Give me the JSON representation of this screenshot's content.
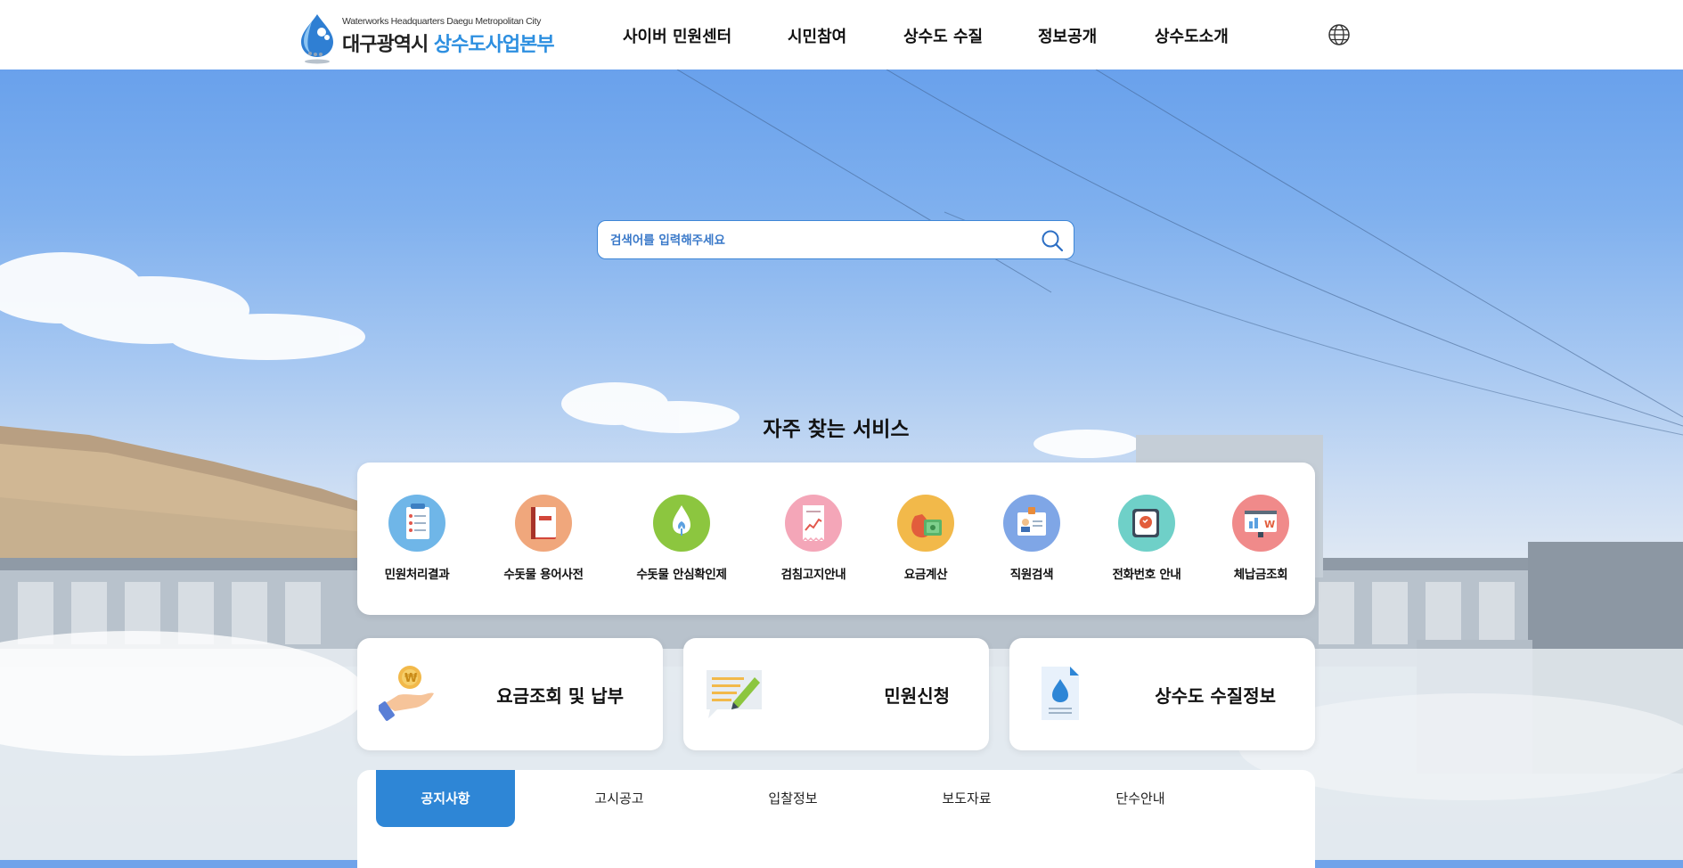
{
  "header": {
    "logo_sub": "Waterworks Headquarters Daegu Metropolitan City",
    "logo_main_1": "대구광역시 ",
    "logo_main_2": "상수도사업본부",
    "nav": [
      "사이버 민원센터",
      "시민참여",
      "상수도 수질",
      "정보공개",
      "상수도소개"
    ],
    "language_icon": "globe-icon"
  },
  "search": {
    "placeholder": "검색어를 입력해주세요",
    "icon": "search-icon"
  },
  "services": {
    "title": "자주 찾는 서비스",
    "items": [
      {
        "label": "민원처리결과",
        "icon": "checklist-icon",
        "color": "#6fb6e8"
      },
      {
        "label": "수돗물 용어사전",
        "icon": "book-icon",
        "color": "#f0a77c"
      },
      {
        "label": "수돗물 안심확인제",
        "icon": "water-drop-leaf-icon",
        "color": "#8cc63f"
      },
      {
        "label": "검침고지안내",
        "icon": "bill-chart-icon",
        "color": "#f4a6b8"
      },
      {
        "label": "요금계산",
        "icon": "money-bag-icon",
        "color": "#f2b94a"
      },
      {
        "label": "직원검색",
        "icon": "id-card-icon",
        "color": "#7fa6e6"
      },
      {
        "label": "전화번호 안내",
        "icon": "phone-icon",
        "color": "#6fd0c8"
      },
      {
        "label": "체납금조회",
        "icon": "monitor-won-icon",
        "color": "#f08a8a"
      }
    ]
  },
  "cards": [
    {
      "label": "요금조회 및 납부",
      "icon": "coin-hand-icon"
    },
    {
      "label": "민원신청",
      "icon": "memo-pencil-icon"
    },
    {
      "label": "상수도 수질정보",
      "icon": "water-document-icon"
    }
  ],
  "tabs": [
    "공지사항",
    "고시공고",
    "입찰정보",
    "보도자료",
    "단수안내"
  ],
  "colors": {
    "accent": "#2e86d6",
    "brand": "#2d8fe0"
  }
}
